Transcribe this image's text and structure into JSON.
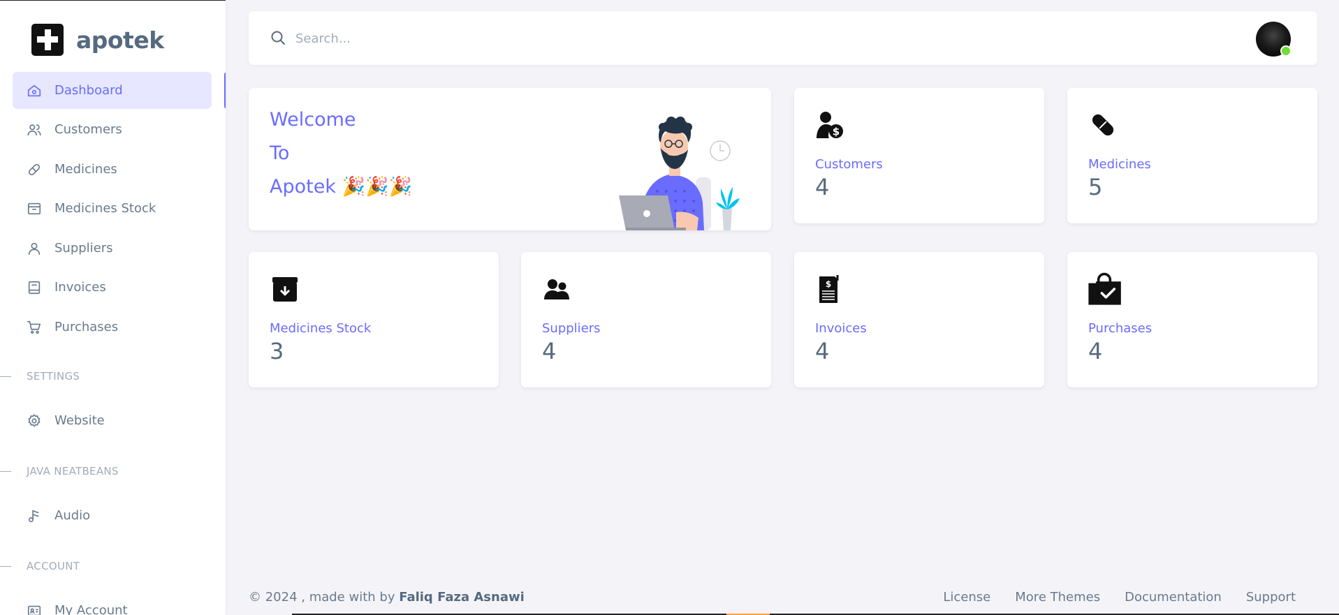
{
  "brand": {
    "name": "apotek"
  },
  "sidebar": {
    "items": [
      {
        "label": "Dashboard",
        "icon": "home-icon",
        "active": true
      },
      {
        "label": "Customers",
        "icon": "users-icon"
      },
      {
        "label": "Medicines",
        "icon": "pill-icon"
      },
      {
        "label": "Medicines Stock",
        "icon": "archive-icon"
      },
      {
        "label": "Suppliers",
        "icon": "user-icon"
      },
      {
        "label": "Invoices",
        "icon": "book-icon"
      },
      {
        "label": "Purchases",
        "icon": "cart-icon"
      }
    ],
    "headers": {
      "settings": "SETTINGS",
      "java": "JAVA NEATBEANS",
      "account": "ACCOUNT"
    },
    "settings_items": [
      {
        "label": "Website",
        "icon": "gear-icon"
      }
    ],
    "java_items": [
      {
        "label": "Audio",
        "icon": "music-note-icon"
      }
    ],
    "account_items": [
      {
        "label": "My Account",
        "icon": "id-card-icon"
      }
    ]
  },
  "search": {
    "placeholder": "Search..."
  },
  "welcome": {
    "line1": "Welcome",
    "line2": "To",
    "line3": "Apotek 🎉🎉🎉"
  },
  "stats": {
    "customers": {
      "label": "Customers",
      "value": "4"
    },
    "medicines": {
      "label": "Medicines",
      "value": "5"
    },
    "medicines_stock": {
      "label": "Medicines Stock",
      "value": "3"
    },
    "suppliers": {
      "label": "Suppliers",
      "value": "4"
    },
    "invoices": {
      "label": "Invoices",
      "value": "4"
    },
    "purchases": {
      "label": "Purchases",
      "value": "4"
    }
  },
  "footer": {
    "prefix": "© 2024 , made with by ",
    "author": "Faliq Faza Asnawi",
    "links": [
      "License",
      "More Themes",
      "Documentation",
      "Support"
    ]
  },
  "colors": {
    "primary": "#696cff",
    "text": "#566a7f",
    "active_bg": "#e7e7ff",
    "online": "#71dd37"
  }
}
